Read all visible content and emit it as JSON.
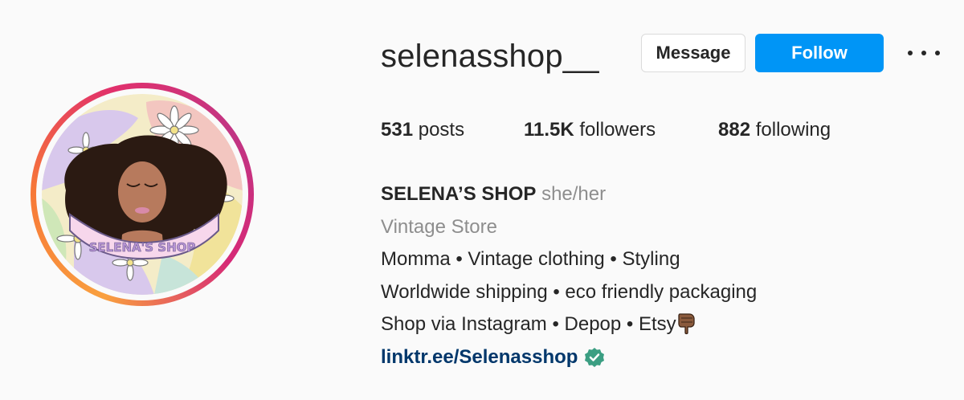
{
  "profile": {
    "username": "selenasshop__",
    "message_label": "Message",
    "follow_label": "Follow",
    "more_icon": "more-options-icon"
  },
  "stats": {
    "posts_count": "531",
    "posts_label": "posts",
    "followers_count": "11.5K",
    "followers_label": "followers",
    "following_count": "882",
    "following_label": "following"
  },
  "bio": {
    "name": "SELENA’S SHOP",
    "pronouns": "she/her",
    "category": "Vintage Store",
    "line1": "Momma • Vintage clothing • Styling",
    "line2": "Worldwide shipping • eco friendly packaging",
    "line3": "Shop via Instagram • Depop • Etsy",
    "link": "linktr.ee/Selenasshop",
    "link_icon": "verified-check-icon",
    "emoji_icon": "pointing-down-hand-icon"
  },
  "avatar": {
    "logo_text": "SELENA'S SHOP"
  },
  "colors": {
    "follow_bg": "#0095f6",
    "link": "#00376b",
    "muted": "#8e8e8e",
    "verified": "#3b9e82"
  }
}
